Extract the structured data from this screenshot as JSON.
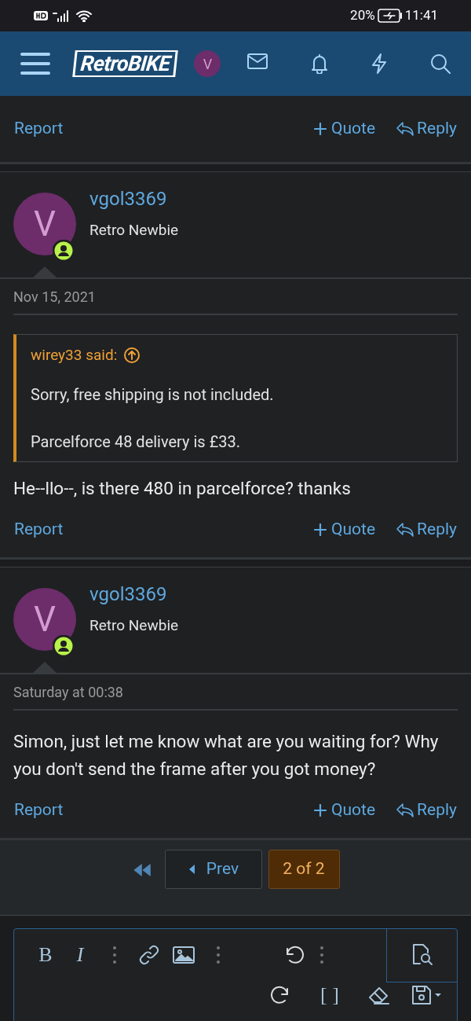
{
  "status_bar": {
    "battery": "20%",
    "time": "11:41"
  },
  "header": {
    "logo": "RetroBIKE",
    "avatar_letter": "V"
  },
  "posts": [
    {
      "actions": {
        "report": "Report",
        "quote": "Quote",
        "reply": "Reply"
      }
    },
    {
      "user": {
        "avatar_letter": "V",
        "name": "vgol3369",
        "title": "Retro Newbie"
      },
      "date": "Nov 15, 2021",
      "quote": {
        "author": "wirey33 said:",
        "lines": [
          "Sorry, free shipping is not included.",
          "Parcelforce 48 delivery is £33."
        ]
      },
      "body": [
        "He--llo--, is there 480 in parcelforce? thanks"
      ],
      "actions": {
        "report": "Report",
        "quote": "Quote",
        "reply": "Reply"
      }
    },
    {
      "user": {
        "avatar_letter": "V",
        "name": "vgol3369",
        "title": "Retro Newbie"
      },
      "date": "Saturday at 00:38",
      "body": [
        "Simon, just let me know what are you waiting for? Why you don't send the frame after you got money?"
      ],
      "actions": {
        "report": "Report",
        "quote": "Quote",
        "reply": "Reply"
      }
    }
  ],
  "pagination": {
    "prev": "Prev",
    "pages": [
      {
        "label": "2 of 2",
        "selected": true
      }
    ]
  },
  "editor": {
    "toolbar": [
      {
        "kind": "text",
        "label": "B"
      },
      {
        "kind": "italic",
        "label": "I"
      },
      {
        "kind": "more"
      },
      {
        "kind": "link"
      },
      {
        "kind": "image"
      },
      {
        "kind": "more"
      },
      {
        "kind": "undo"
      },
      {
        "kind": "more"
      }
    ],
    "toolbar_row2": [
      {
        "kind": "redo"
      },
      {
        "kind": "text",
        "label": "[ ]"
      },
      {
        "kind": "eraser"
      },
      {
        "kind": "save"
      }
    ]
  }
}
